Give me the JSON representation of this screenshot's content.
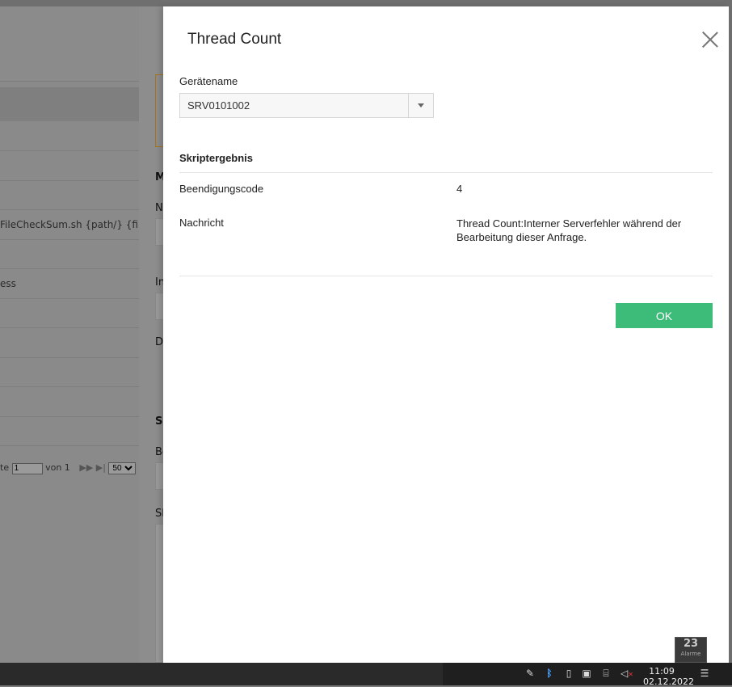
{
  "background": {
    "rows": [
      "",
      "",
      "",
      "FileCheckSum.sh {path/} {file} #",
      "",
      "ess",
      "",
      "",
      "",
      "",
      ""
    ],
    "pager": {
      "prefix": "te",
      "page_value": "1",
      "of_label": "von 1",
      "per_page": "50"
    },
    "mid_labels": [
      "M",
      "N",
      "In",
      "D",
      "Sl",
      "Be",
      "Sl"
    ]
  },
  "dialog": {
    "title": "Thread Count",
    "device_label": "Gerätename",
    "device_value": "SRV0101002",
    "section_title": "Skriptergebnis",
    "exit_code_label": "Beendigungscode",
    "exit_code_value": "4",
    "message_label": "Nachricht",
    "message_value": "Thread Count:Interner Serverfehler während der Bearbeitung dieser Anfrage.",
    "ok_label": "OK"
  },
  "alarm": {
    "count": "23",
    "label": "Alarme"
  },
  "taskbar": {
    "time": "11:09",
    "date": "02.12.2022"
  },
  "colors": {
    "ok_button": "#3dbb79",
    "accent_border": "#a8741a"
  },
  "icons": [
    "close-icon",
    "dropdown-arrow-icon",
    "pen-icon",
    "bluetooth-icon",
    "usb-icon",
    "app-icon",
    "network-icon",
    "speaker-muted-icon",
    "notification-icon"
  ]
}
